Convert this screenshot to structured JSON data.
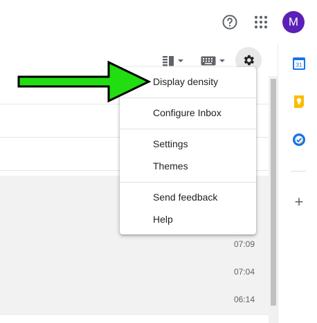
{
  "header": {
    "avatar_letter": "M",
    "help_icon": "help-circle-icon",
    "apps_icon": "apps-grid-icon"
  },
  "toolbar": {
    "split_icon": "split-pane-icon",
    "keyboard_icon": "keyboard-icon",
    "settings_icon": "gear-icon"
  },
  "menu": {
    "display_density": "Display density",
    "configure_inbox": "Configure Inbox",
    "settings": "Settings",
    "themes": "Themes",
    "send_feedback": "Send feedback",
    "help": "Help"
  },
  "rows": [
    {
      "time": ""
    },
    {
      "time": ""
    },
    {
      "time": ""
    },
    {
      "time": ""
    },
    {
      "time": ""
    },
    {
      "time": "07:09"
    },
    {
      "time": "07:04"
    },
    {
      "time": "06:14"
    }
  ],
  "sidepanel": {
    "calendar_label": "31",
    "calendar_icon": "calendar-icon",
    "keep_icon": "keep-bulb-icon",
    "tasks_icon": "tasks-check-icon",
    "add_icon": "+"
  },
  "colors": {
    "avatar": "#5b21b6",
    "arrow": "#22dd11",
    "calendar": "#1a73e8",
    "keep": "#fbbc04",
    "tasks": "#1a73e8"
  }
}
